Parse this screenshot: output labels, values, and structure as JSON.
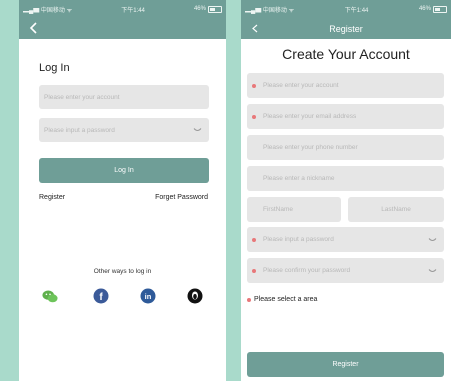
{
  "colors": {
    "teal": "#6f9e97",
    "background": "#a9dacb",
    "field": "#e6e6e6",
    "required_dot": "#e8787a"
  },
  "statusbar": {
    "carrier": "中国移动",
    "time": "下午1:44",
    "battery": "46%"
  },
  "login": {
    "title": "Log In",
    "account_placeholder": "Please enter your account",
    "password_placeholder": "Please input a password",
    "login_button": "Log In",
    "register_link": "Register",
    "forget_link": "Forget Password",
    "other_ways": "Other ways to log in",
    "social_icons": [
      "wechat-icon",
      "facebook-icon",
      "linkedin-icon",
      "qq-icon"
    ]
  },
  "register": {
    "nav_title": "Register",
    "title": "Create Your Account",
    "fields": [
      "Please enter your account",
      "Please enter your email address",
      "Please enter your phone number",
      "Please enter a nickname"
    ],
    "firstname": "FirstName",
    "lastname": "LastName",
    "password": "Please input a password",
    "confirm_password": "Please confirm your password",
    "area": "Please select a area",
    "register_button": "Register"
  }
}
